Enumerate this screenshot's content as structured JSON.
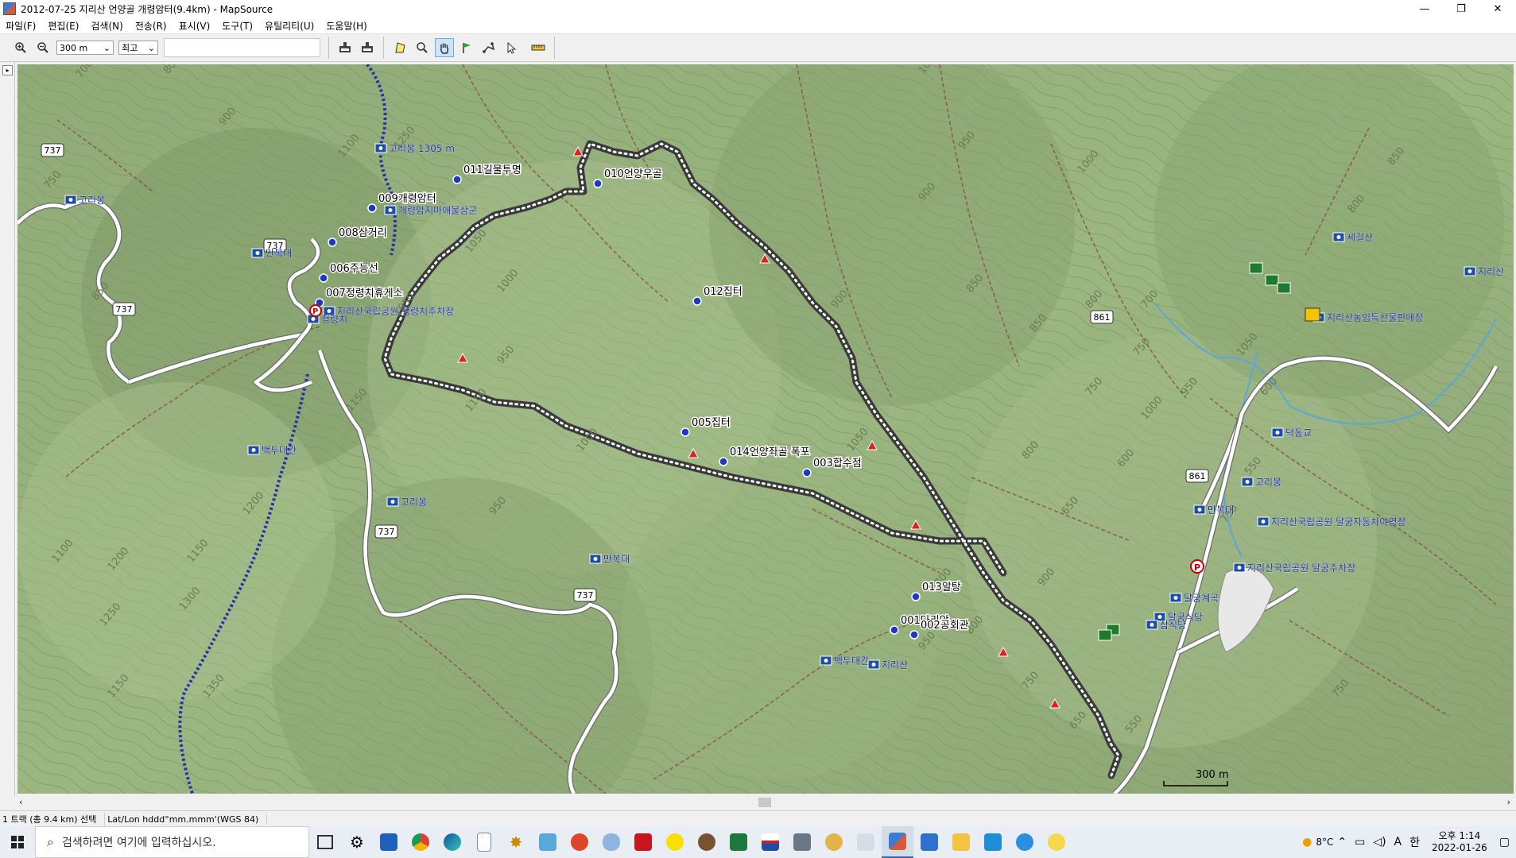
{
  "window": {
    "title": "2012-07-25 지리산 언양골 개령암터(9.4km) - MapSource",
    "controls": [
      "—",
      "❐",
      "✕"
    ]
  },
  "menu": [
    "파일(F)",
    "편집(E)",
    "검색(N)",
    "전송(R)",
    "표시(V)",
    "도구(T)",
    "유틸리티(U)",
    "도움말(H)"
  ],
  "toolbar": {
    "zoom_value": "300 m",
    "detail_value": "최고"
  },
  "map": {
    "waypoints": [
      {
        "id": "w011",
        "label": "011길물투명"
      },
      {
        "id": "w010",
        "label": "010언양우골"
      },
      {
        "id": "w009",
        "label": "009개령암터"
      },
      {
        "id": "w008",
        "label": "008삼거리"
      },
      {
        "id": "w006",
        "label": "006주능선"
      },
      {
        "id": "w007",
        "label": "007정령치휴게소"
      },
      {
        "id": "w012",
        "label": "012집터"
      },
      {
        "id": "w005",
        "label": "005집터"
      },
      {
        "id": "w014",
        "label": "014언양좌골 폭포"
      },
      {
        "id": "w003",
        "label": "003합수점"
      },
      {
        "id": "w013",
        "label": "013알탕"
      },
      {
        "id": "w001",
        "label": "001다리앞"
      },
      {
        "id": "w002",
        "label": "002공회관"
      }
    ],
    "pois": [
      {
        "id": "p1",
        "label": "고리봉 1305 m"
      },
      {
        "id": "p2",
        "label": "고리봉"
      },
      {
        "id": "p3",
        "label": "만복대"
      },
      {
        "id": "p4",
        "label": "지리산국립공원 정령치주차장"
      },
      {
        "id": "p5",
        "label": "정령치"
      },
      {
        "id": "p6",
        "label": "개령암지마애불상군"
      },
      {
        "id": "p7",
        "label": "고리봉"
      },
      {
        "id": "p8",
        "label": "만복대"
      },
      {
        "id": "p9",
        "label": "세걸산"
      },
      {
        "id": "p10",
        "label": "지리산농임특산물판매장"
      },
      {
        "id": "p11",
        "label": "덕동교"
      },
      {
        "id": "p12",
        "label": "고리봉"
      },
      {
        "id": "p13",
        "label": "지리산국립공원 달궁자동차야영장"
      },
      {
        "id": "p14",
        "label": "지리산국립공원 달궁주차장"
      },
      {
        "id": "p15",
        "label": "달궁계곡"
      },
      {
        "id": "p16",
        "label": "만복대"
      },
      {
        "id": "p17",
        "label": "백두대간"
      },
      {
        "id": "p18",
        "label": "지리산"
      },
      {
        "id": "p19",
        "label": "달궁식당"
      },
      {
        "id": "p20",
        "label": "삼식당"
      },
      {
        "id": "p21",
        "label": "지리산"
      },
      {
        "id": "p22",
        "label": "백두대간"
      }
    ],
    "road_shields": [
      "737",
      "737",
      "737",
      "737",
      "737",
      "861",
      "861"
    ],
    "contour_labels": [
      "800",
      "700",
      "900",
      "1100",
      "1250",
      "750",
      "850",
      "1050",
      "1000",
      "1050",
      "1150",
      "950",
      "900",
      "1100",
      "1200",
      "1150",
      "1100",
      "1200",
      "1300",
      "1250",
      "1150",
      "1350",
      "1050",
      "1000",
      "950",
      "1000",
      "950",
      "900",
      "850",
      "800",
      "750",
      "700",
      "650",
      "600",
      "750",
      "950",
      "850",
      "800",
      "700",
      "900",
      "800",
      "750",
      "650",
      "550",
      "600",
      "1050",
      "1000",
      "800",
      "850",
      "750",
      "1000",
      "950",
      "550",
      "750"
    ],
    "scale_label": "300 m"
  },
  "status": {
    "selection": "1 트랙 (총 9.4 km) 선택",
    "coords": "Lat/Lon hddd°mm.mmm'(WGS 84)"
  },
  "taskbar": {
    "search_placeholder": "검색하려면 여기에 입력하십시오.",
    "weather": "8°C",
    "time": "오후 1:14",
    "date": "2022-01-26",
    "ime": "A",
    "lang": "한"
  }
}
